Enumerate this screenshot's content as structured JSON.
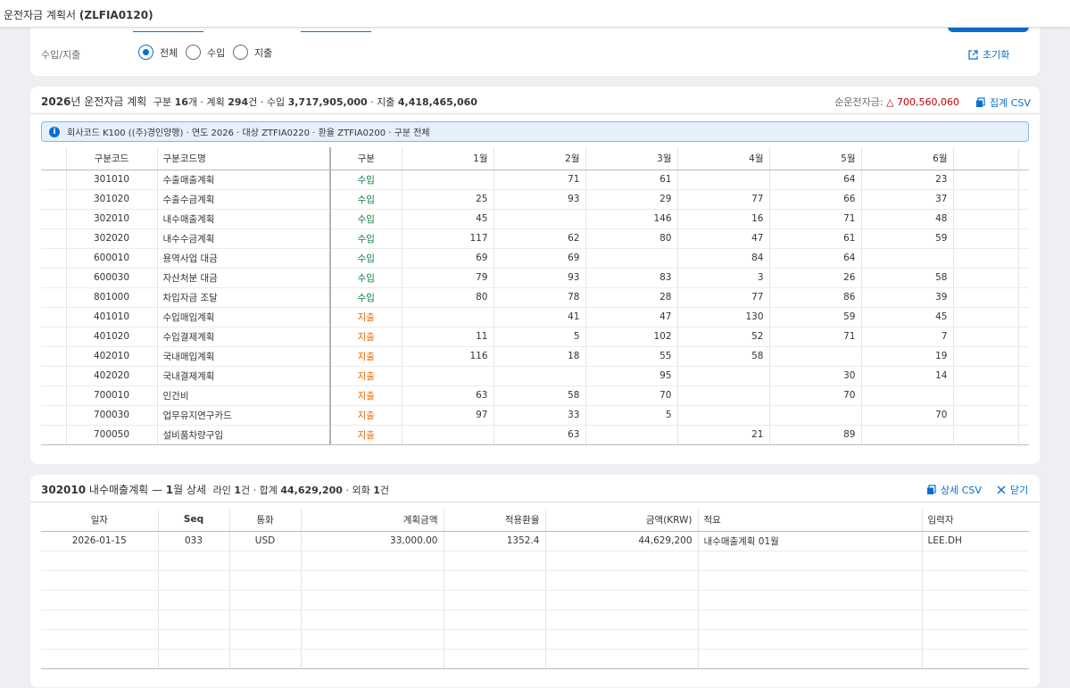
{
  "app": {
    "title_main": "운전자금 계획서 ",
    "title_code": "(ZLFIA0120)"
  },
  "filter": {
    "label": "수입/지출",
    "options": [
      "전체",
      "수입",
      "지출"
    ],
    "selected": 0,
    "reset_label": "초기화"
  },
  "summary": {
    "year": "2026",
    "title_suffix": "년 운전자금 계획",
    "p1": "구분 ",
    "n_codes": "16",
    "p2": "개 · 계획 ",
    "n_plans": "294",
    "p3": "건 · 수입 ",
    "income": "3,717,905,000",
    "p4": " · 지출 ",
    "expense": "4,418,465,060",
    "net_label": "순운전자금: ",
    "net_value": "△ 700,560,060",
    "csv_label": "집계 CSV"
  },
  "info_banner": "회사코드 K100 ((주)경인양행) · 연도 2026 · 대상 ZTFIA0220 · 환율 ZTFIA0200 · 구분 전체",
  "main_table": {
    "headers": [
      "구분코드",
      "구분코드명",
      "구분",
      "1월",
      "2월",
      "3월",
      "4월",
      "5월",
      "6월"
    ],
    "rows": [
      {
        "code": "301010",
        "name": "수출매출계획",
        "type": "수입",
        "kind": "inc",
        "m": [
          "",
          "71",
          "61",
          "",
          "64",
          "23"
        ]
      },
      {
        "code": "301020",
        "name": "수출수금계획",
        "type": "수입",
        "kind": "inc",
        "m": [
          "25",
          "93",
          "29",
          "77",
          "66",
          "37"
        ]
      },
      {
        "code": "302010",
        "name": "내수매출계획",
        "type": "수입",
        "kind": "inc",
        "m": [
          "45",
          "",
          "146",
          "16",
          "71",
          "48"
        ]
      },
      {
        "code": "302020",
        "name": "내수수금계획",
        "type": "수입",
        "kind": "inc",
        "m": [
          "117",
          "62",
          "80",
          "47",
          "61",
          "59"
        ]
      },
      {
        "code": "600010",
        "name": "용역사업 대금",
        "type": "수입",
        "kind": "inc",
        "m": [
          "69",
          "69",
          "",
          "84",
          "64",
          ""
        ]
      },
      {
        "code": "600030",
        "name": "자산처분 대금",
        "type": "수입",
        "kind": "inc",
        "m": [
          "79",
          "93",
          "83",
          "3",
          "26",
          "58"
        ]
      },
      {
        "code": "801000",
        "name": "차입자금 조달",
        "type": "수입",
        "kind": "inc",
        "m": [
          "80",
          "78",
          "28",
          "77",
          "86",
          "39"
        ]
      },
      {
        "code": "401010",
        "name": "수입매입계획",
        "type": "지출",
        "kind": "exp",
        "m": [
          "",
          "41",
          "47",
          "130",
          "59",
          "45"
        ]
      },
      {
        "code": "401020",
        "name": "수입결제계획",
        "type": "지출",
        "kind": "exp",
        "m": [
          "11",
          "5",
          "102",
          "52",
          "71",
          "7"
        ]
      },
      {
        "code": "402010",
        "name": "국내매입계획",
        "type": "지출",
        "kind": "exp",
        "m": [
          "116",
          "18",
          "55",
          "58",
          "",
          "19"
        ]
      },
      {
        "code": "402020",
        "name": "국내결제계획",
        "type": "지출",
        "kind": "exp",
        "m": [
          "",
          "",
          "95",
          "",
          "30",
          "14"
        ]
      },
      {
        "code": "700010",
        "name": "인건비",
        "type": "지출",
        "kind": "exp",
        "m": [
          "63",
          "58",
          "70",
          "",
          "70",
          ""
        ]
      },
      {
        "code": "700030",
        "name": "업무유지연구카드",
        "type": "지출",
        "kind": "exp",
        "m": [
          "97",
          "33",
          "5",
          "",
          "",
          "70"
        ]
      },
      {
        "code": "700050",
        "name": "설비품차량구입",
        "type": "지출",
        "kind": "exp",
        "m": [
          "",
          "63",
          "",
          "21",
          "89",
          ""
        ]
      }
    ]
  },
  "detail": {
    "code": "302010",
    "name": " 내수매출계획 — ",
    "month": "1",
    "month_suffix": "월 상세",
    "q1": "라인 ",
    "lines": "1",
    "q2": "건 · 합계 ",
    "total": "44,629,200",
    "q3": " · 외화 ",
    "fx": "1",
    "q4": "건",
    "csv_label": "상세 CSV",
    "close_label": "닫기",
    "headers": [
      "일자",
      "Seq",
      "통화",
      "계획금액",
      "적용환율",
      "금액(KRW)",
      "적요",
      "입력자"
    ],
    "rows": [
      {
        "date": "2026-01-15",
        "seq": "033",
        "cur": "USD",
        "plan": "33,000.00",
        "rate": "1352.4",
        "krw": "44,629,200",
        "memo": "내수매출계획 01월",
        "user": "LEE.DH"
      }
    ]
  }
}
